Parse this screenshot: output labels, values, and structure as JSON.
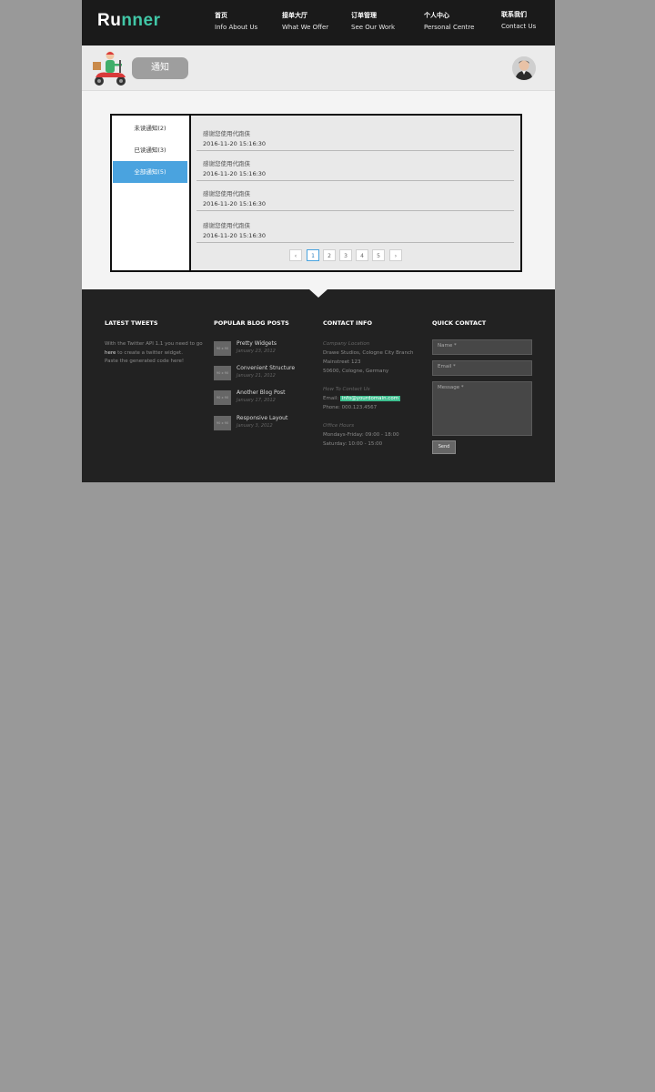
{
  "header": {
    "logo_part1": "Ru",
    "logo_part2": "nn",
    "logo_part3": "er",
    "nav": [
      {
        "cn": "首页",
        "en": "Info About Us"
      },
      {
        "cn": "接单大厅",
        "en": "What We Offer"
      },
      {
        "cn": "订单管理",
        "en": "See Our Work"
      },
      {
        "cn": "个人中心",
        "en": "Personal Centre"
      },
      {
        "cn": "联系我们",
        "en": "Contact Us"
      }
    ],
    "accent_color": "#41c7a7"
  },
  "subheader": {
    "title": "通知",
    "icon": "scooter-delivery-icon",
    "avatar_icon": "user-avatar-icon"
  },
  "notifications": {
    "tabs": [
      {
        "label": "未读通知(2)"
      },
      {
        "label": "已读通知(3)"
      },
      {
        "label": "全部通知(5)"
      }
    ],
    "active_tab_color": "#4aa3df",
    "items": [
      {
        "title": "感谢您使用代跑侠",
        "date": "2016-11-20 15:16:30"
      },
      {
        "title": "感谢您使用代跑侠",
        "date": "2016-11-20 15:16:30"
      },
      {
        "title": "感谢您使用代跑侠",
        "date": "2016-11-20 15:16:30"
      },
      {
        "title": "感谢您使用代跑侠",
        "date": "2016-11-20 15:16:30"
      }
    ],
    "pagination": {
      "prev": "‹",
      "pages": [
        "1",
        "2",
        "3",
        "4",
        "5"
      ],
      "next": "›",
      "current": "1"
    }
  },
  "footer": {
    "tweets": {
      "title": "LATEST TWEETS",
      "line1": "With the Twitter API 1.1 you need to go",
      "line2_hl": "here",
      "line2_rest": " to create a twitter widget.",
      "line3": "Paste the generated code here!"
    },
    "blog": {
      "title": "POPULAR BLOG POSTS",
      "thumb_label": "90 x 90",
      "posts": [
        {
          "title": "Pretty Widgets",
          "date": "January 23, 2012"
        },
        {
          "title": "Convenient Structure",
          "date": "January 21, 2012"
        },
        {
          "title": "Another Blog Post",
          "date": "January 17, 2012"
        },
        {
          "title": "Responsive Layout",
          "date": "January 3, 2012"
        }
      ]
    },
    "contact": {
      "title": "CONTACT INFO",
      "location_label": "Company Location",
      "address1": "Drawe Studios, Cologne City Branch",
      "address2": "Mainstreet 123",
      "address3": "50600, Cologne, Germany",
      "how_label": "How To Contact Us",
      "email_prefix": "Email:",
      "email": "info@yourdomain.com",
      "phone": "Phone: 000.123.4567",
      "hours_label": "Office Hours",
      "hours1": "Mondays-Friday: 09:00 - 18:00",
      "hours2": "Saturday: 10:00 - 15:00"
    },
    "quick": {
      "title": "QUICK CONTACT",
      "name_placeholder": "Name *",
      "email_placeholder": "Email *",
      "message_placeholder": "Message *",
      "send_label": "Send"
    }
  }
}
